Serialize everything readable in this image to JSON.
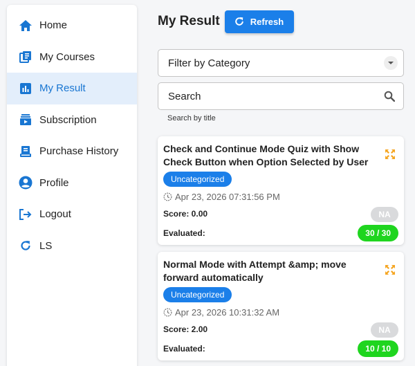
{
  "sidebar": {
    "items": [
      {
        "label": "Home",
        "icon": "home-icon"
      },
      {
        "label": "My Courses",
        "icon": "courses-icon"
      },
      {
        "label": "My Result",
        "icon": "bar-chart-icon",
        "active": true
      },
      {
        "label": "Subscription",
        "icon": "subscription-icon"
      },
      {
        "label": "Purchase History",
        "icon": "receipt-icon"
      },
      {
        "label": "Profile",
        "icon": "profile-icon"
      },
      {
        "label": "Logout",
        "icon": "logout-icon"
      },
      {
        "label": "LS",
        "icon": "refresh-icon"
      }
    ]
  },
  "header": {
    "title": "My Result",
    "refresh_label": "Refresh"
  },
  "filter": {
    "category_value": "Filter by Category",
    "search_placeholder": "Search",
    "search_helper": "Search by title"
  },
  "results": [
    {
      "title": "Check and Continue Mode Quiz with Show Check Button when Option Selected by User",
      "category": "Uncategorized",
      "date": "Apr 23, 2026 07:31:56 PM",
      "score_label": "Score: 0.00",
      "score_chip": "NA",
      "evaluated_label": "Evaluated:",
      "evaluated_value": "30 / 30"
    },
    {
      "title": "Normal Mode with Attempt &amp; move forward automatically",
      "category": "Uncategorized",
      "date": "Apr 23, 2026 10:31:32 AM",
      "score_label": "Score: 2.00",
      "score_chip": "NA",
      "evaluated_label": "Evaluated:",
      "evaluated_value": "10 / 10"
    }
  ],
  "colors": {
    "primary": "#1b7fe9",
    "active_bg": "#e3eefb",
    "success": "#1fd51f",
    "expand_icon": "#f5a623"
  }
}
